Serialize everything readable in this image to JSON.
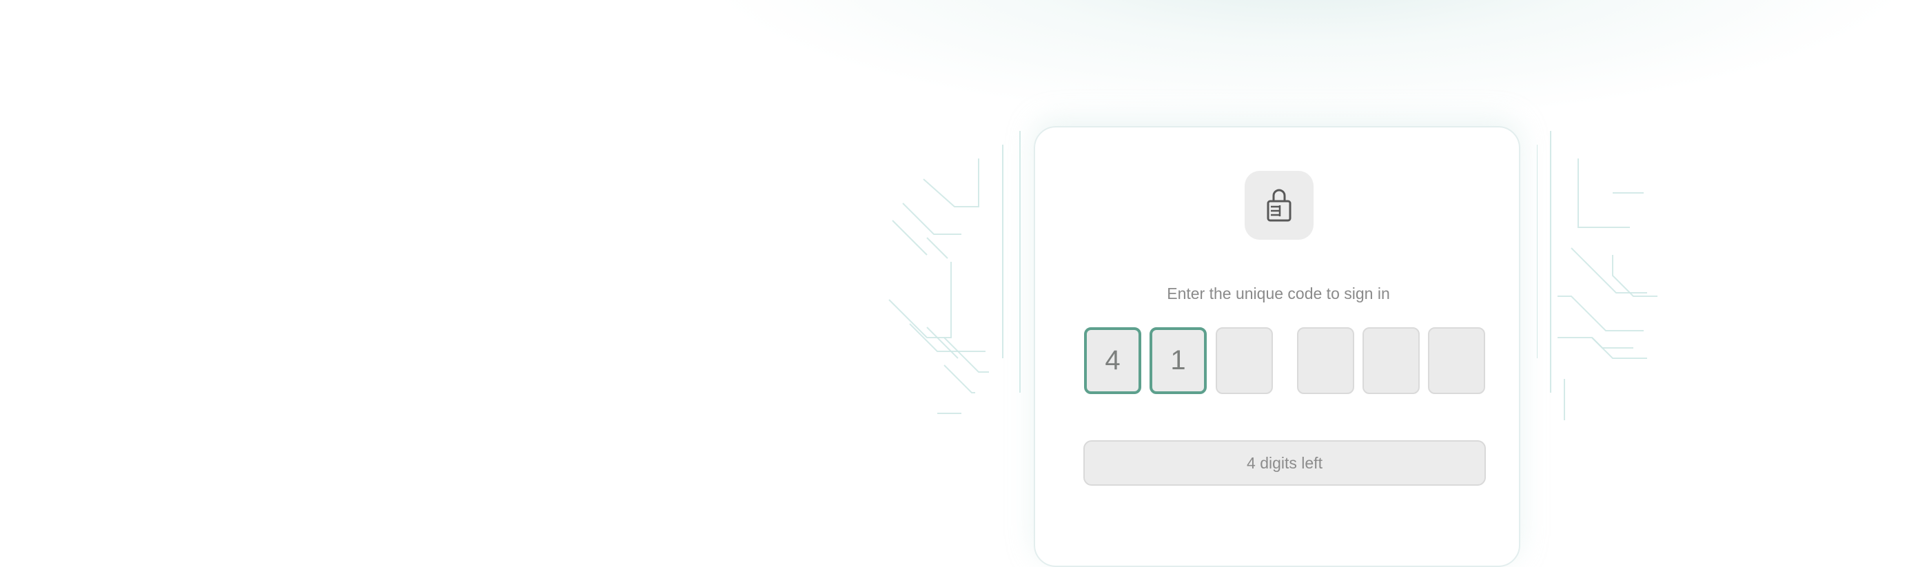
{
  "signin": {
    "prompt": "Enter the unique code to sign in",
    "code_digits": [
      "4",
      "1",
      "",
      "",
      "",
      ""
    ],
    "status_label": "4 digits left"
  },
  "icons": {
    "lock": "lock-icon"
  },
  "colors": {
    "accent": "#5da08d",
    "card_border": "#e3eeee",
    "box_fill": "#ebebeb",
    "muted_text": "#8a8a8a"
  }
}
